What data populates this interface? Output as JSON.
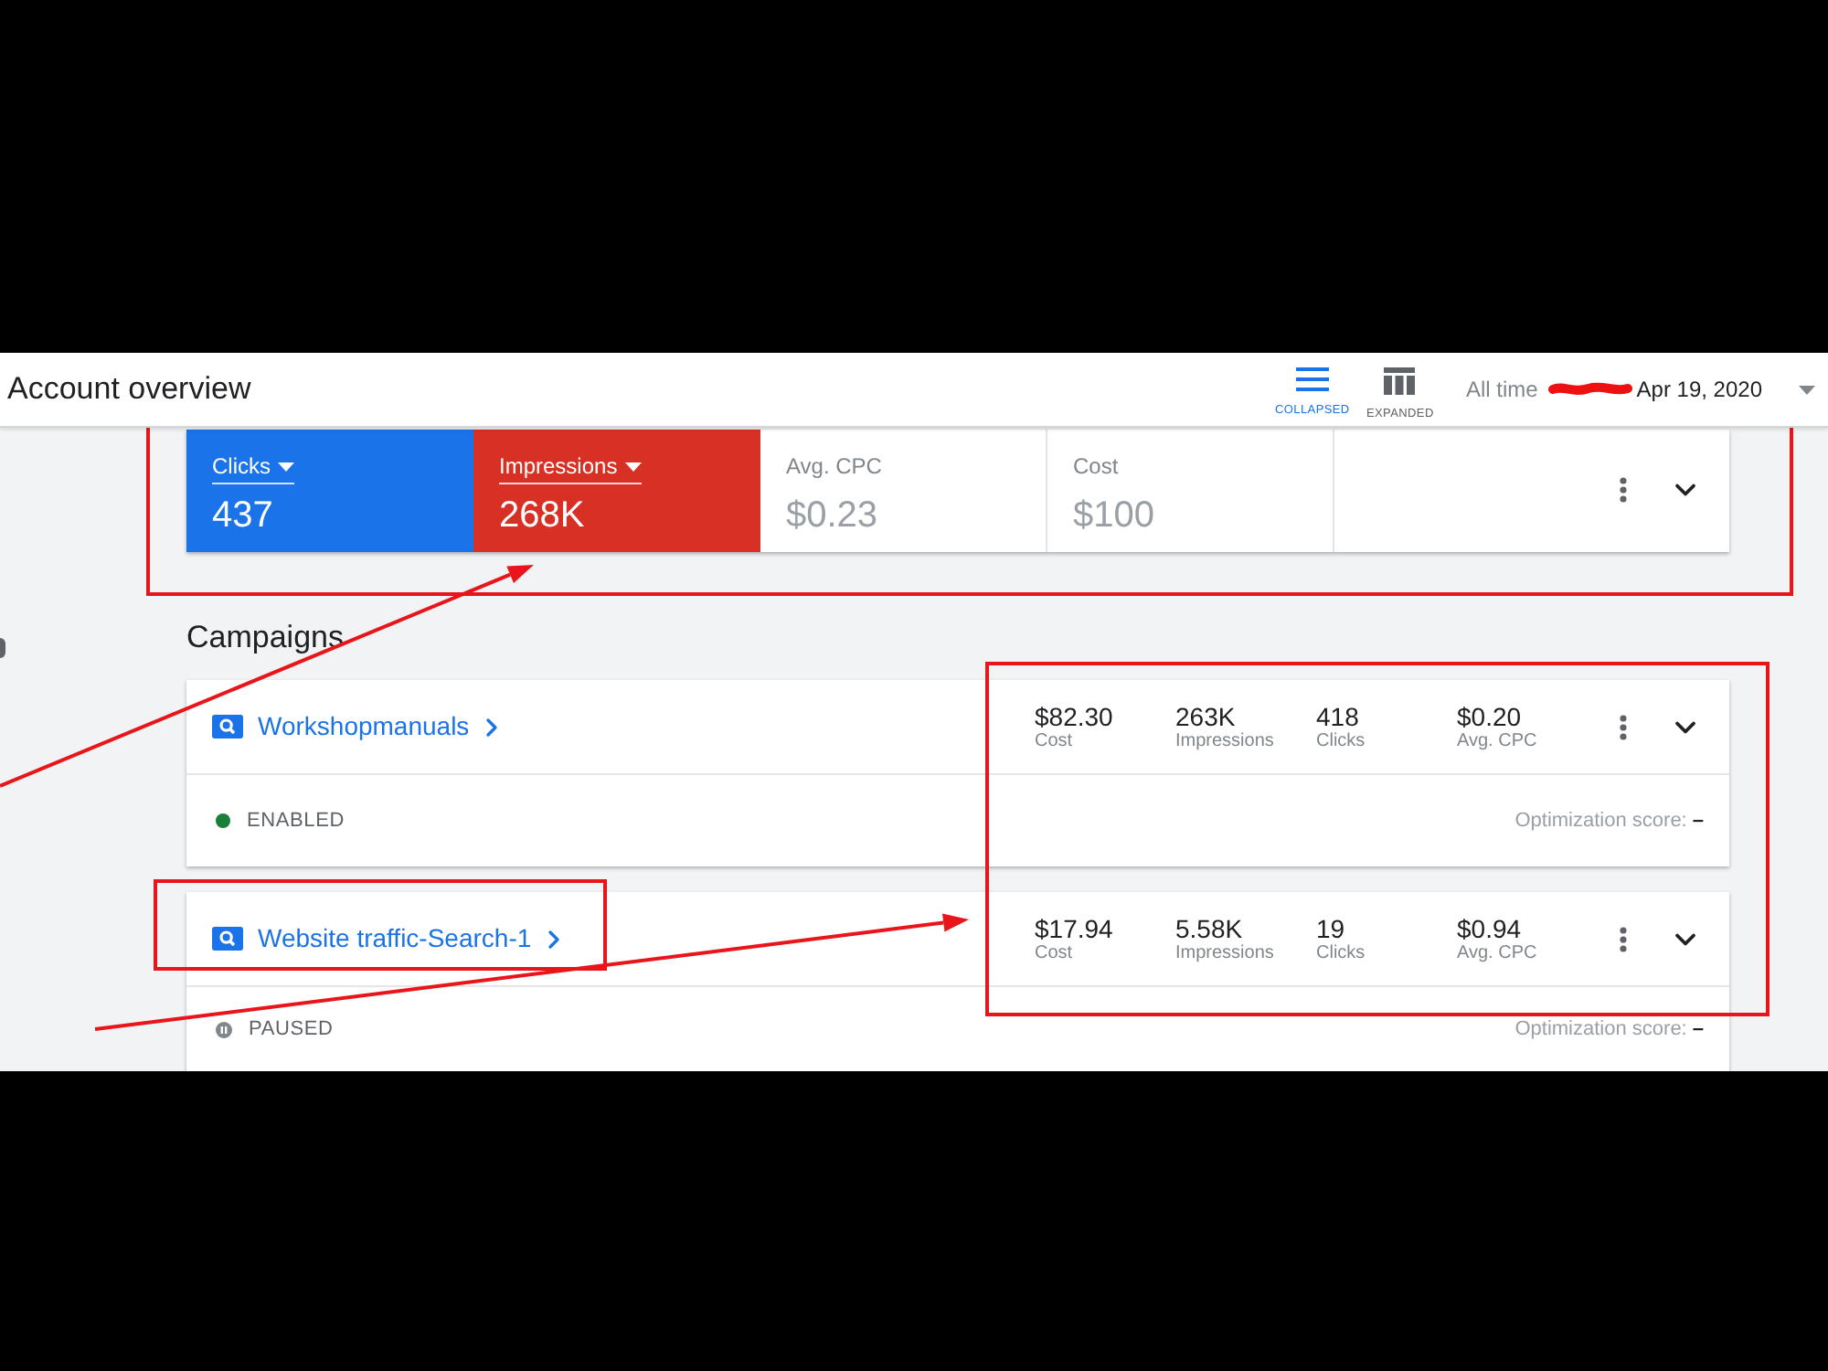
{
  "header": {
    "title": "Account overview",
    "view_toggle": [
      {
        "label": "COLLAPSED",
        "kind": "list",
        "selected": true
      },
      {
        "label": "EXPANDED",
        "kind": "columns",
        "selected": false
      }
    ],
    "date_range": {
      "preset": "All time",
      "redacted": true,
      "end": "Apr 19, 2020"
    }
  },
  "metrics": [
    {
      "label": "Clicks",
      "value": "437",
      "selected": true,
      "color": "#1a73e8"
    },
    {
      "label": "Impressions",
      "value": "268K",
      "selected": true,
      "color": "#d93025"
    },
    {
      "label": "Avg. CPC",
      "value": "$0.23",
      "selected": false
    },
    {
      "label": "Cost",
      "value": "$100",
      "selected": false
    }
  ],
  "campaigns_title": "Campaigns",
  "campaigns": [
    {
      "name": "Workshopmanuals",
      "stats": [
        {
          "value": "$82.30",
          "label": "Cost"
        },
        {
          "value": "263K",
          "label": "Impressions"
        },
        {
          "value": "418",
          "label": "Clicks"
        },
        {
          "value": "$0.20",
          "label": "Avg. CPC"
        }
      ],
      "status": {
        "kind": "enabled",
        "label": "ENABLED"
      },
      "optimization": {
        "label": "Optimization score:",
        "value": "–"
      }
    },
    {
      "name": "Website traffic-Search-1",
      "stats": [
        {
          "value": "$17.94",
          "label": "Cost"
        },
        {
          "value": "5.58K",
          "label": "Impressions"
        },
        {
          "value": "19",
          "label": "Clicks"
        },
        {
          "value": "$0.94",
          "label": "Avg. CPC"
        }
      ],
      "status": {
        "kind": "paused",
        "label": "PAUSED"
      },
      "optimization": {
        "label": "Optimization score:",
        "value": "–"
      }
    }
  ],
  "annotations": [
    {
      "kind": "box"
    },
    {
      "kind": "arrow"
    },
    {
      "kind": "box"
    },
    {
      "kind": "box"
    },
    {
      "kind": "arrow"
    }
  ]
}
